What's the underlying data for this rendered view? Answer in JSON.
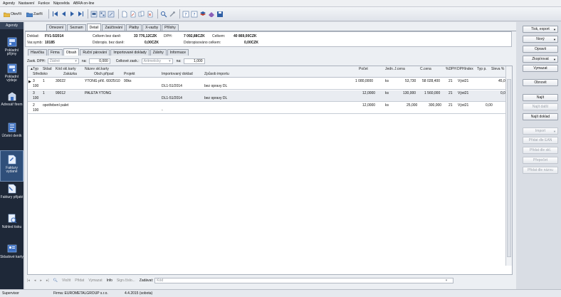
{
  "menu": [
    "Agendy",
    "Nastavení",
    "Funkce",
    "Nápověda",
    "ABRA on-line"
  ],
  "toolbar": {
    "open": "Otevřít",
    "close": "Zavřít"
  },
  "sidebar": {
    "title": "Agendy",
    "items": [
      {
        "label": "Pokladní příjmy",
        "icon": "cash-receipt-icon"
      },
      {
        "label": "Pokladní výdeje",
        "icon": "cash-expense-icon"
      },
      {
        "label": "Adresář firem",
        "icon": "address-book-icon"
      },
      {
        "label": "Účetní deník",
        "icon": "ledger-icon"
      },
      {
        "label": "Faktury vydané",
        "icon": "issued-invoice-icon"
      },
      {
        "label": "Faktury přijaté",
        "icon": "received-invoice-icon"
      },
      {
        "label": "Náhled tisku",
        "icon": "print-preview-icon"
      },
      {
        "label": "Skladové karty",
        "icon": "stock-card-icon"
      }
    ]
  },
  "main_tabs": [
    "Omezení",
    "Seznam",
    "Detail",
    "Zaúčtování",
    "Platby",
    "X-vazby",
    "Přílohy"
  ],
  "summary": {
    "doklad_label": "Doklad:",
    "doklad": "FV1-5/2014",
    "varsym_label": "Var.symb:",
    "varsym": "10185",
    "celkem_bez_dph_label": "Celkem bez daně:",
    "celkem_bez_dph": "33 776,12CZK",
    "dph_label": "DPH:",
    "dph": "7 092,88CZK",
    "celkem_label": "Celkem:",
    "celkem": "40 869,00CZK",
    "dobropis_bez_label": "Dobropis. bez daně:",
    "dobropis_bez": "0,00CZK",
    "dobropis_celkem_label": "Dobropisováno celkem:",
    "dobropis_celkem": "0,00CZK"
  },
  "sub_tabs": [
    "Hlavička",
    "Firma",
    "Obsah",
    "Ruční párování",
    "Importované doklady",
    "Zálohy",
    "Informace"
  ],
  "filter": {
    "zaok_dph_label": "Zaok. DPH:",
    "zaok_dph": "Žádné",
    "na1_label": "na:",
    "na1": "0,000",
    "celk_zaok_label": "Celkové zaok.:",
    "celk_zaok": "Aritmeticky",
    "na2_label": "na:",
    "na2": "1,000"
  },
  "grid_headers_row1": [
    "Typ",
    "Sklad",
    "Kód skl.karty",
    "Název skl.karty",
    "Počet",
    "Jedn.",
    "J.cena",
    "C.cena",
    "%DPH",
    "DPHIndex",
    "Typ p.",
    "Sleva %"
  ],
  "grid_headers_row2": [
    "Středisko",
    "Zakázka",
    "Obch.případ",
    "Projekt",
    "Importovaný doklad",
    "Způsob importu"
  ],
  "rows": [
    {
      "typ": "3",
      "sklad": "1",
      "kod": "30022",
      "nazev": "YTONG příč. 60/25/10",
      "obch": "90ks",
      "pocet": "1 080,0000",
      "jedn": "ks",
      "jcena": "53,730",
      "ccena": "58 028,400",
      "dph": "21",
      "dphindex": "Výst21",
      "slevap": "45,00",
      "str": "100",
      "imp": "DL1-51/2014",
      "zpusob": "bez opravy DL"
    },
    {
      "typ": "3",
      "sklad": "1",
      "kod": "99012",
      "nazev": "PALETA YTONG",
      "obch": "",
      "pocet": "12,0000",
      "jedn": "ks",
      "jcena": "130,000",
      "ccena": "1 560,000",
      "dph": "21",
      "dphindex": "Výst21",
      "slevap": "0,00",
      "str": "100",
      "imp": "DL1-51/2014",
      "zpusob": "bez opravy DL"
    },
    {
      "typ": "2",
      "sklad": "",
      "kod": "",
      "nazev": "opotřebení palet",
      "obch": "",
      "pocet": "12,0000",
      "jedn": "ks",
      "jcena": "25,000",
      "ccena": "300,000",
      "dph": "21",
      "dphindex": "Výst21",
      "slevap": "0,00",
      "str": "100",
      "imp": "-",
      "zpusob": ""
    }
  ],
  "bottom": [
    "Vložit",
    "Přidat",
    "Vymazat",
    "Info",
    "Sign.číslo...",
    "Zadávat:"
  ],
  "bottom_field": "Kód",
  "right_buttons": [
    {
      "label": "Tisk, export",
      "dd": true,
      "enabled": true
    },
    {
      "label": "Nový",
      "dd": true,
      "enabled": true
    },
    {
      "label": "Opravit",
      "dd": false,
      "enabled": true
    },
    {
      "label": "Zkopírovat",
      "dd": true,
      "enabled": true
    },
    {
      "label": "Vymazat",
      "dd": false,
      "enabled": true
    },
    {
      "label": "Obnovit",
      "dd": false,
      "enabled": true
    },
    {
      "label": "Najít",
      "dd": false,
      "enabled": true
    },
    {
      "label": "Najít další",
      "dd": false,
      "enabled": false
    },
    {
      "label": "Najít doklad",
      "dd": false,
      "enabled": true
    },
    {
      "label": "Import",
      "dd": true,
      "enabled": false
    },
    {
      "label": "Přidat dle EAN",
      "dd": false,
      "enabled": false
    },
    {
      "label": "Přidat dle skl.",
      "dd": false,
      "enabled": false
    },
    {
      "label": "Přepočet",
      "dd": false,
      "enabled": false
    },
    {
      "label": "Přidat dle názvu",
      "dd": false,
      "enabled": false
    }
  ],
  "status": {
    "user": "Supervisor",
    "firma": "Firma: EUROMETALGROUP s.r.o.",
    "date": "4.4.2015 (sobota)"
  }
}
